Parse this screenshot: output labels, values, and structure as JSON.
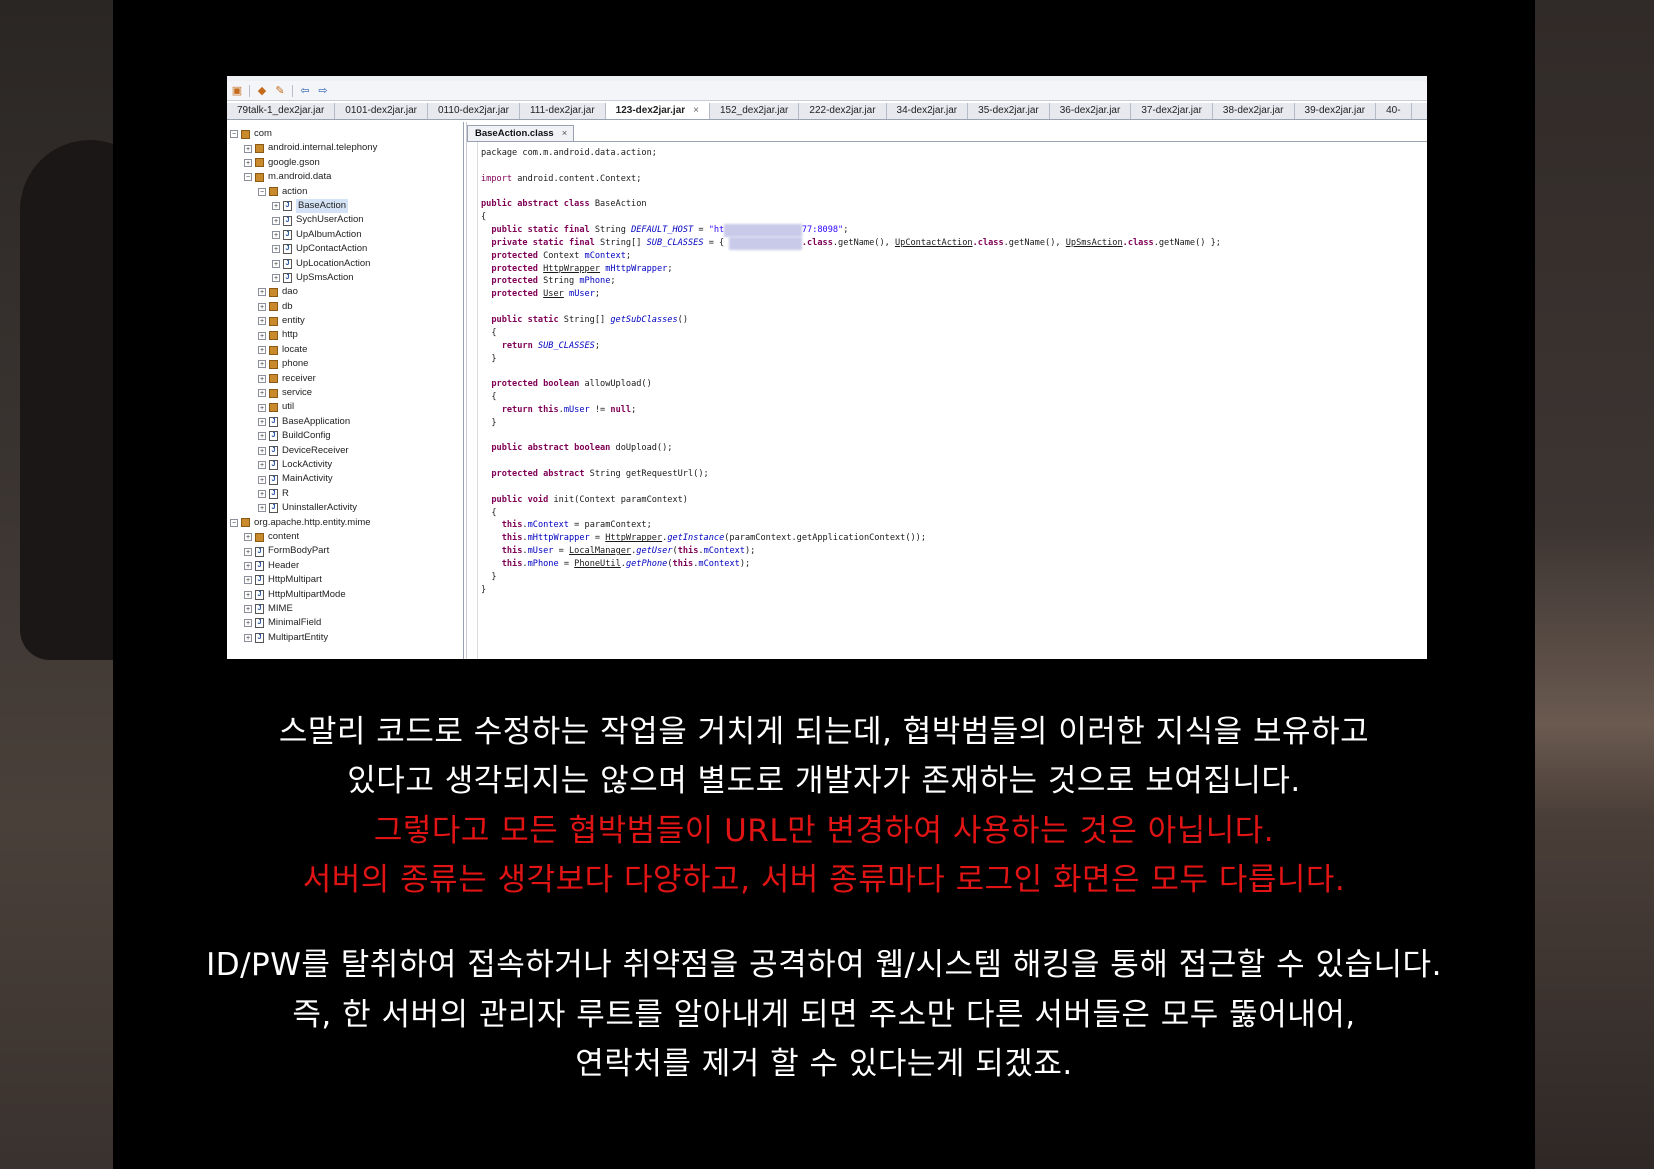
{
  "toolbar": {
    "icons": [
      "open-file-icon",
      "save-icon",
      "edit-icon",
      "back-icon",
      "forward-icon"
    ]
  },
  "tabs": [
    {
      "label": "79talk-1_dex2jar.jar",
      "active": false
    },
    {
      "label": "0101-dex2jar.jar",
      "active": false
    },
    {
      "label": "0110-dex2jar.jar",
      "active": false
    },
    {
      "label": "111-dex2jar.jar",
      "active": false
    },
    {
      "label": "123-dex2jar.jar",
      "active": true
    },
    {
      "label": "152_dex2jar.jar",
      "active": false
    },
    {
      "label": "222-dex2jar.jar",
      "active": false
    },
    {
      "label": "34-dex2jar.jar",
      "active": false
    },
    {
      "label": "35-dex2jar.jar",
      "active": false
    },
    {
      "label": "36-dex2jar.jar",
      "active": false
    },
    {
      "label": "37-dex2jar.jar",
      "active": false
    },
    {
      "label": "38-dex2jar.jar",
      "active": false
    },
    {
      "label": "39-dex2jar.jar",
      "active": false
    },
    {
      "label": "40-",
      "active": false
    }
  ],
  "tree": [
    {
      "label": "com",
      "kind": "pkg",
      "depth": 0
    },
    {
      "label": "android.internal.telephony",
      "kind": "pkg",
      "depth": 1
    },
    {
      "label": "google.gson",
      "kind": "pkg",
      "depth": 1
    },
    {
      "label": "m.android.data",
      "kind": "pkg",
      "depth": 1
    },
    {
      "label": "action",
      "kind": "pkg",
      "depth": 2
    },
    {
      "label": "BaseAction",
      "kind": "cls",
      "depth": 3,
      "selected": true
    },
    {
      "label": "SychUserAction",
      "kind": "cls",
      "depth": 3
    },
    {
      "label": "UpAlbumAction",
      "kind": "cls",
      "depth": 3
    },
    {
      "label": "UpContactAction",
      "kind": "cls",
      "depth": 3
    },
    {
      "label": "UpLocationAction",
      "kind": "cls",
      "depth": 3
    },
    {
      "label": "UpSmsAction",
      "kind": "cls",
      "depth": 3
    },
    {
      "label": "dao",
      "kind": "pkg",
      "depth": 2
    },
    {
      "label": "db",
      "kind": "pkg",
      "depth": 2
    },
    {
      "label": "entity",
      "kind": "pkg",
      "depth": 2
    },
    {
      "label": "http",
      "kind": "pkg",
      "depth": 2
    },
    {
      "label": "locate",
      "kind": "pkg",
      "depth": 2
    },
    {
      "label": "phone",
      "kind": "pkg",
      "depth": 2
    },
    {
      "label": "receiver",
      "kind": "pkg",
      "depth": 2
    },
    {
      "label": "service",
      "kind": "pkg",
      "depth": 2
    },
    {
      "label": "util",
      "kind": "pkg",
      "depth": 2
    },
    {
      "label": "BaseApplication",
      "kind": "cls",
      "depth": 2
    },
    {
      "label": "BuildConfig",
      "kind": "cls",
      "depth": 2
    },
    {
      "label": "DeviceReceiver",
      "kind": "cls",
      "depth": 2
    },
    {
      "label": "LockActivity",
      "kind": "cls",
      "depth": 2
    },
    {
      "label": "MainActivity",
      "kind": "cls",
      "depth": 2
    },
    {
      "label": "R",
      "kind": "cls",
      "depth": 2
    },
    {
      "label": "UninstallerActivity",
      "kind": "cls",
      "depth": 2
    },
    {
      "label": "org.apache.http.entity.mime",
      "kind": "pkg",
      "depth": 0
    },
    {
      "label": "content",
      "kind": "pkg",
      "depth": 1
    },
    {
      "label": "FormBodyPart",
      "kind": "cls",
      "depth": 1
    },
    {
      "label": "Header",
      "kind": "cls",
      "depth": 1
    },
    {
      "label": "HttpMultipart",
      "kind": "cls",
      "depth": 1
    },
    {
      "label": "HttpMultipartMode",
      "kind": "cls",
      "depth": 1
    },
    {
      "label": "MIME",
      "kind": "cls",
      "depth": 1
    },
    {
      "label": "MinimalField",
      "kind": "cls",
      "depth": 1
    },
    {
      "label": "MultipartEntity",
      "kind": "cls",
      "depth": 1
    }
  ],
  "editor": {
    "tab_label": "BaseAction.class",
    "close_glyph": "×",
    "code_lines": [
      [
        {
          "t": "package com.m.android.data.action;"
        }
      ],
      [
        {
          "t": ""
        }
      ],
      [
        {
          "t": "import",
          "c": "kw2"
        },
        {
          "t": " android.content.Context;"
        }
      ],
      [
        {
          "t": ""
        }
      ],
      [
        {
          "t": "public abstract class",
          "c": "kw"
        },
        {
          "t": " BaseAction"
        }
      ],
      [
        {
          "t": "{"
        }
      ],
      [
        {
          "t": "  "
        },
        {
          "t": "public static final",
          "c": "kw"
        },
        {
          "t": " String "
        },
        {
          "t": "DEFAULT_HOST",
          "c": "fld"
        },
        {
          "t": " = "
        },
        {
          "t": "\"ht",
          "c": "str"
        },
        {
          "t": "tp://000.000.00",
          "c": "blur"
        },
        {
          "t": "77:8098\"",
          "c": "str"
        },
        {
          "t": ";"
        }
      ],
      [
        {
          "t": "  "
        },
        {
          "t": "private static final",
          "c": "kw"
        },
        {
          "t": " String[] "
        },
        {
          "t": "SUB_CLASSES",
          "c": "fld"
        },
        {
          "t": " = { "
        },
        {
          "t": "SychUserAction",
          "c": "blur"
        },
        {
          "t": ".class",
          "c": "kw"
        },
        {
          "t": ".getName(), "
        },
        {
          "t": "UpContactAction",
          "c": "ul"
        },
        {
          "t": ".class",
          "c": "kw"
        },
        {
          "t": ".getName(), "
        },
        {
          "t": "UpSmsAction",
          "c": "ul"
        },
        {
          "t": ".class",
          "c": "kw"
        },
        {
          "t": ".getName() };"
        }
      ],
      [
        {
          "t": "  "
        },
        {
          "t": "protected",
          "c": "kw"
        },
        {
          "t": " Context "
        },
        {
          "t": "mContext",
          "c": "ifld"
        },
        {
          "t": ";"
        }
      ],
      [
        {
          "t": "  "
        },
        {
          "t": "protected",
          "c": "kw"
        },
        {
          "t": " "
        },
        {
          "t": "HttpWrapper",
          "c": "ul"
        },
        {
          "t": " "
        },
        {
          "t": "mHttpWrapper",
          "c": "ifld"
        },
        {
          "t": ";"
        }
      ],
      [
        {
          "t": "  "
        },
        {
          "t": "protected",
          "c": "kw"
        },
        {
          "t": " String "
        },
        {
          "t": "mPhone",
          "c": "ifld"
        },
        {
          "t": ";"
        }
      ],
      [
        {
          "t": "  "
        },
        {
          "t": "protected",
          "c": "kw"
        },
        {
          "t": " "
        },
        {
          "t": "User",
          "c": "ul"
        },
        {
          "t": " "
        },
        {
          "t": "mUser",
          "c": "ifld"
        },
        {
          "t": ";"
        }
      ],
      [
        {
          "t": ""
        }
      ],
      [
        {
          "t": "  "
        },
        {
          "t": "public static",
          "c": "kw"
        },
        {
          "t": " String[] "
        },
        {
          "t": "getSubClasses",
          "c": "fld"
        },
        {
          "t": "()"
        }
      ],
      [
        {
          "t": "  {"
        }
      ],
      [
        {
          "t": "    "
        },
        {
          "t": "return",
          "c": "kw"
        },
        {
          "t": " "
        },
        {
          "t": "SUB_CLASSES",
          "c": "fld"
        },
        {
          "t": ";"
        }
      ],
      [
        {
          "t": "  }"
        }
      ],
      [
        {
          "t": ""
        }
      ],
      [
        {
          "t": "  "
        },
        {
          "t": "protected boolean",
          "c": "kw"
        },
        {
          "t": " allowUpload()"
        }
      ],
      [
        {
          "t": "  {"
        }
      ],
      [
        {
          "t": "    "
        },
        {
          "t": "return this",
          "c": "kw"
        },
        {
          "t": "."
        },
        {
          "t": "mUser",
          "c": "ifld"
        },
        {
          "t": " != "
        },
        {
          "t": "null",
          "c": "kw"
        },
        {
          "t": ";"
        }
      ],
      [
        {
          "t": "  }"
        }
      ],
      [
        {
          "t": ""
        }
      ],
      [
        {
          "t": "  "
        },
        {
          "t": "public abstract boolean",
          "c": "kw"
        },
        {
          "t": " doUpload();"
        }
      ],
      [
        {
          "t": ""
        }
      ],
      [
        {
          "t": "  "
        },
        {
          "t": "protected abstract",
          "c": "kw"
        },
        {
          "t": " String getRequestUrl();"
        }
      ],
      [
        {
          "t": ""
        }
      ],
      [
        {
          "t": "  "
        },
        {
          "t": "public void",
          "c": "kw"
        },
        {
          "t": " init(Context paramContext)"
        }
      ],
      [
        {
          "t": "  {"
        }
      ],
      [
        {
          "t": "    "
        },
        {
          "t": "this",
          "c": "kw"
        },
        {
          "t": "."
        },
        {
          "t": "mContext",
          "c": "ifld"
        },
        {
          "t": " = paramContext;"
        }
      ],
      [
        {
          "t": "    "
        },
        {
          "t": "this",
          "c": "kw"
        },
        {
          "t": "."
        },
        {
          "t": "mHttpWrapper",
          "c": "ifld"
        },
        {
          "t": " = "
        },
        {
          "t": "HttpWrapper",
          "c": "ul"
        },
        {
          "t": "."
        },
        {
          "t": "getInstance",
          "c": "fld"
        },
        {
          "t": "(paramContext.getApplicationContext());"
        }
      ],
      [
        {
          "t": "    "
        },
        {
          "t": "this",
          "c": "kw"
        },
        {
          "t": "."
        },
        {
          "t": "mUser",
          "c": "ifld"
        },
        {
          "t": " = "
        },
        {
          "t": "LocalManager",
          "c": "ul"
        },
        {
          "t": "."
        },
        {
          "t": "getUser",
          "c": "fld"
        },
        {
          "t": "("
        },
        {
          "t": "this",
          "c": "kw"
        },
        {
          "t": "."
        },
        {
          "t": "mContext",
          "c": "ifld"
        },
        {
          "t": ");"
        }
      ],
      [
        {
          "t": "    "
        },
        {
          "t": "this",
          "c": "kw"
        },
        {
          "t": "."
        },
        {
          "t": "mPhone",
          "c": "ifld"
        },
        {
          "t": " = "
        },
        {
          "t": "PhoneUtil",
          "c": "ul"
        },
        {
          "t": "."
        },
        {
          "t": "getPhone",
          "c": "fld"
        },
        {
          "t": "("
        },
        {
          "t": "this",
          "c": "kw"
        },
        {
          "t": "."
        },
        {
          "t": "mContext",
          "c": "ifld"
        },
        {
          "t": ");"
        }
      ],
      [
        {
          "t": "  }"
        }
      ],
      [
        {
          "t": "}"
        }
      ]
    ]
  },
  "captions": {
    "line1": "스말리 코드로 수정하는 작업을 거치게 되는데, 협박범들의 이러한 지식을 보유하고",
    "line2": "있다고 생각되지는 않으며 별도로 개발자가 존재하는 것으로 보여집니다.",
    "line3": "그렇다고 모든 협박범들이 URL만 변경하여 사용하는 것은 아닙니다.",
    "line4": "서버의 종류는 생각보다 다양하고, 서버 종류마다 로그인 화면은 모두 다릅니다.",
    "line5": "ID/PW를 탈취하여 접속하거나 취약점을 공격하여 웹/시스템 해킹을 통해 접근할 수 있습니다.",
    "line6": "즉, 한 서버의 관리자 루트를 알아내게 되면 주소만 다른 서버들은 모두 뚫어내어,",
    "line7": "연락처를 제거 할 수 있다는게 되겠죠."
  },
  "colors": {
    "caption_white": "#ffffff",
    "caption_red": "#e01414",
    "panel_bg": "#000000"
  }
}
